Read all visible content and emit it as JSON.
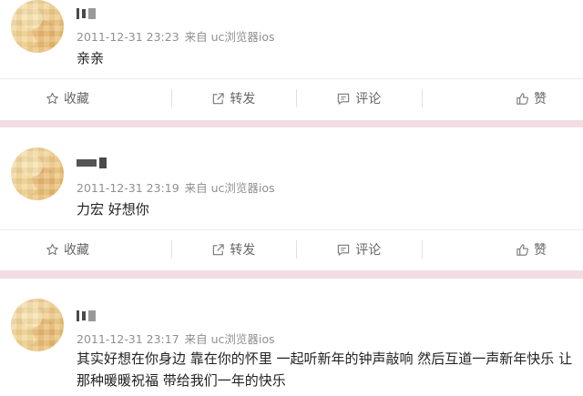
{
  "posts": [
    {
      "timestamp": "2011-12-31 23:23",
      "source": "来自 uc浏览器ios",
      "content": "亲亲"
    },
    {
      "timestamp": "2011-12-31 23:19",
      "source": "来自 uc浏览器ios",
      "content": "力宏  好想你"
    },
    {
      "timestamp": "2011-12-31 23:17",
      "source": "来自 uc浏览器ios",
      "content": "其实好想在你身边  靠在你的怀里  一起听新年的钟声敲响  然后互道一声新年快乐  让那种暖暖祝福  带给我们一年的快乐"
    }
  ],
  "actions": {
    "favorite": "收藏",
    "repost": "转发",
    "comment": "评论",
    "like": "赞"
  },
  "icons": {
    "favorite": "star-icon",
    "repost": "share-icon",
    "comment": "comment-icon",
    "like": "thumbs-up-icon"
  }
}
